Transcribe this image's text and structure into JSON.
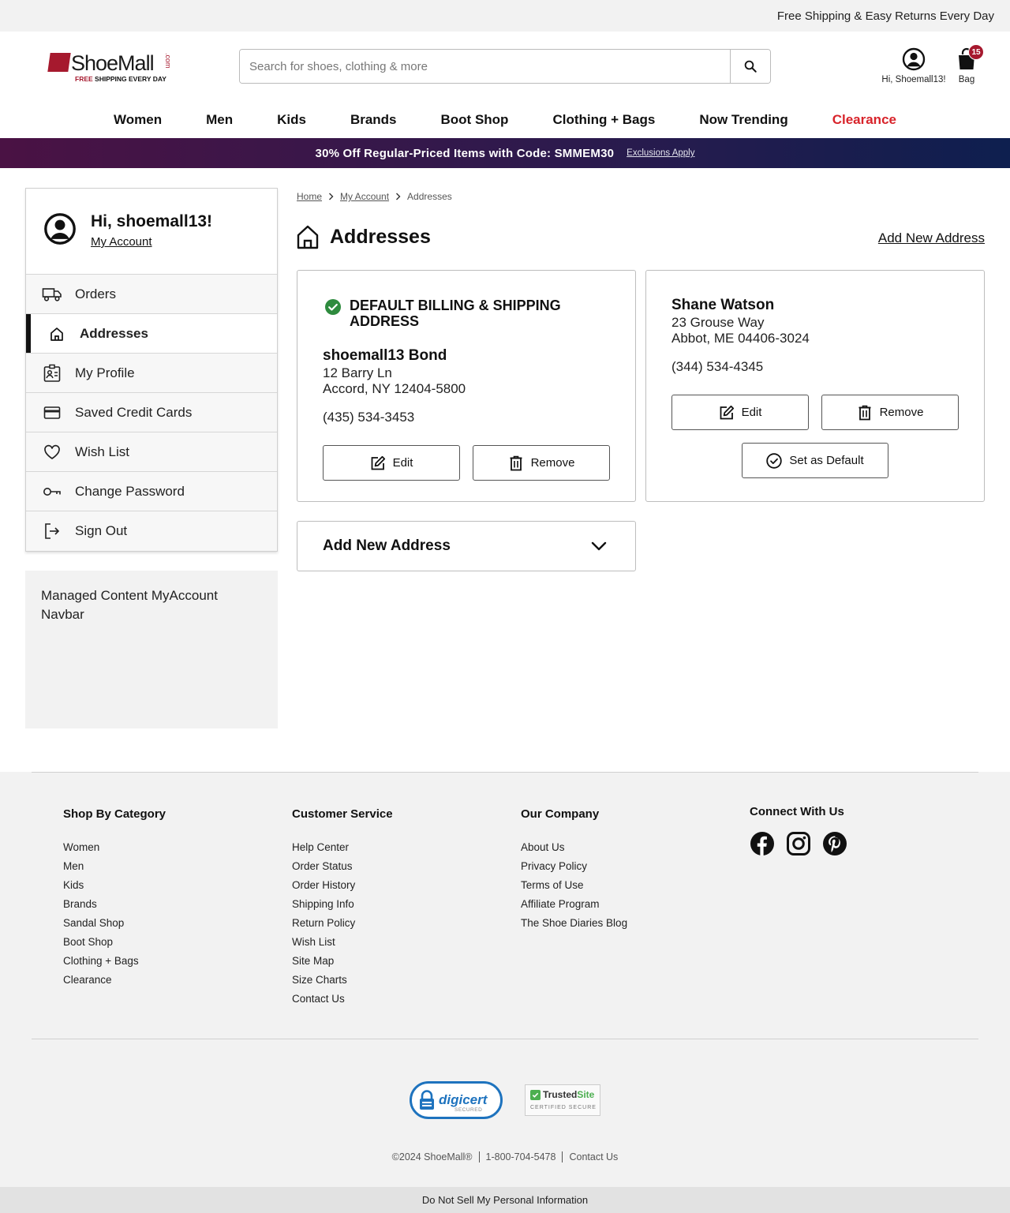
{
  "topbar": {
    "message": "Free Shipping & Easy Returns Every Day"
  },
  "header": {
    "logo_text": "ShoeMall",
    "logo_com": ".com",
    "logo_tag_free": "FREE",
    "logo_tag_rest": " SHIPPING EVERY DAY",
    "search_placeholder": "Search for shoes, clothing & more",
    "account_label": "Hi, Shoemall13!",
    "bag_label": "Bag",
    "bag_count": "15"
  },
  "nav": [
    "Women",
    "Men",
    "Kids",
    "Brands",
    "Boot Shop",
    "Clothing + Bags",
    "Now Trending",
    "Clearance"
  ],
  "promo": {
    "text": "30% Off Regular-Priced Items with Code: SMMEM30",
    "link": "Exclusions Apply"
  },
  "sidebar": {
    "greeting": "Hi, shoemall13!",
    "my_account": "My Account",
    "items": [
      {
        "label": "Orders",
        "icon": "truck-icon"
      },
      {
        "label": "Addresses",
        "icon": "home-icon"
      },
      {
        "label": "My Profile",
        "icon": "profile-badge-icon"
      },
      {
        "label": "Saved Credit Cards",
        "icon": "credit-card-icon"
      },
      {
        "label": "Wish List",
        "icon": "heart-icon"
      },
      {
        "label": "Change Password",
        "icon": "key-icon"
      },
      {
        "label": "Sign Out",
        "icon": "sign-out-icon"
      }
    ],
    "managed_content": "Managed Content MyAccount Navbar"
  },
  "breadcrumb": [
    "Home",
    "My Account",
    "Addresses"
  ],
  "page": {
    "title": "Addresses",
    "add_link": "Add New Address"
  },
  "addresses": [
    {
      "default_label": "DEFAULT BILLING & SHIPPING ADDRESS",
      "name": "shoemall13 Bond",
      "street": "12 Barry Ln",
      "city_line": "Accord, NY 12404-5800",
      "phone": "(435) 534-3453",
      "edit": "Edit",
      "remove": "Remove"
    },
    {
      "name": "Shane Watson",
      "street": "23 Grouse Way",
      "city_line": "Abbot, ME 04406-3024",
      "phone": "(344) 534-4345",
      "edit": "Edit",
      "remove": "Remove",
      "set_default": "Set as Default"
    }
  ],
  "accordion": {
    "label": "Add New Address"
  },
  "footer": {
    "columns": [
      {
        "title": "Shop By Category",
        "links": [
          "Women",
          "Men",
          "Kids",
          "Brands",
          "Sandal Shop",
          "Boot Shop",
          "Clothing + Bags",
          "Clearance"
        ]
      },
      {
        "title": "Customer Service",
        "links": [
          "Help Center",
          "Order Status",
          "Order History",
          "Shipping Info",
          "Return Policy",
          "Wish List",
          "Site Map",
          "Size Charts",
          "Contact Us"
        ]
      },
      {
        "title": "Our Company",
        "links": [
          "About Us",
          "Privacy Policy",
          "Terms of Use",
          "Affiliate Program",
          "The Shoe Diaries Blog"
        ]
      }
    ],
    "connect_title": "Connect With Us",
    "social": [
      "facebook-icon",
      "instagram-icon",
      "pinterest-icon"
    ],
    "digicert_name": "digicert",
    "digicert_sub": "SECURED",
    "trusted_name_1": "Trusted",
    "trusted_name_2": "Site",
    "trusted_sub": "CERTIFIED SECURE",
    "copyright": "©2024 ShoeMall®",
    "phone": "1-800-704-5478",
    "contact": "Contact Us",
    "do_not_sell": "Do Not Sell My Personal Information"
  },
  "colors": {
    "brand_red": "#a6192e",
    "clearance_red": "#d8232a",
    "success_green": "#2e8b3e",
    "promo_start": "#4a1244",
    "promo_end": "#0e1f4f"
  }
}
